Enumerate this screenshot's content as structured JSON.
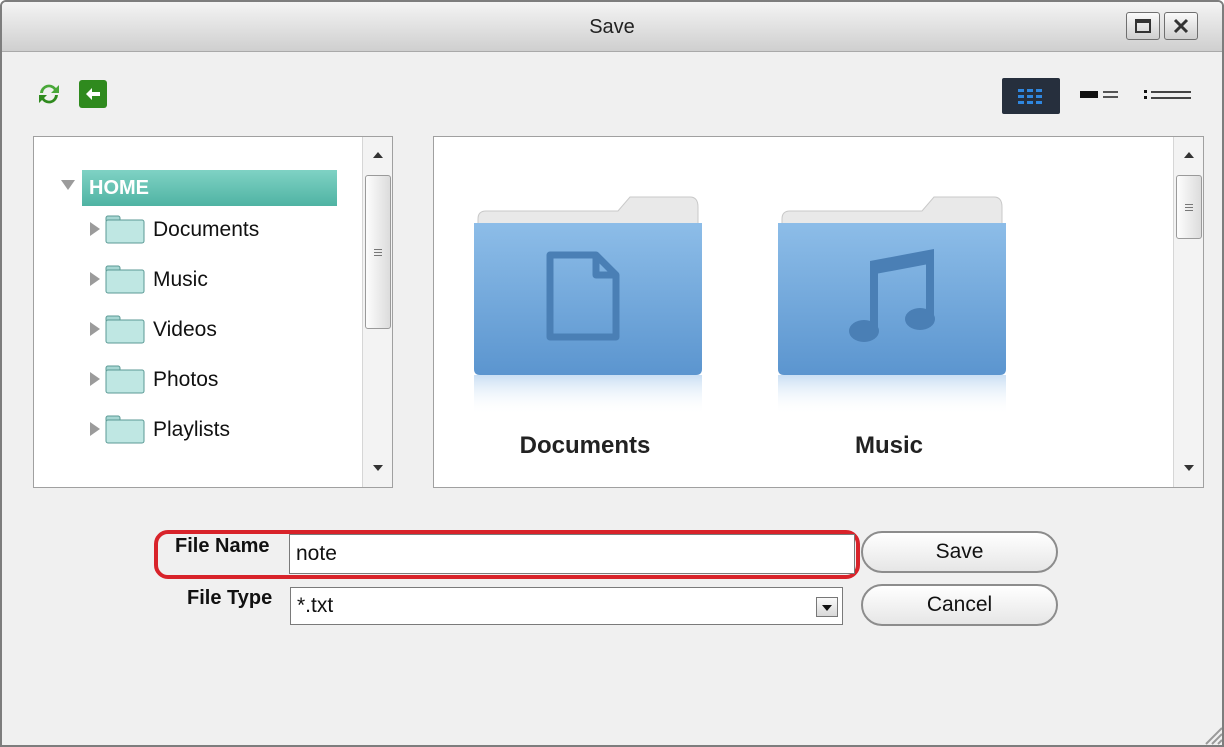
{
  "window": {
    "title": "Save"
  },
  "toolbar": {
    "refresh_icon": "refresh-icon",
    "back_icon": "back-arrow-icon",
    "views": [
      {
        "name": "thumbnails-view-icon",
        "active": true
      },
      {
        "name": "tiles-view-icon",
        "active": false
      },
      {
        "name": "list-view-icon",
        "active": false
      }
    ]
  },
  "tree": {
    "root": "HOME",
    "items": [
      {
        "label": "Documents"
      },
      {
        "label": "Music"
      },
      {
        "label": "Videos"
      },
      {
        "label": "Photos"
      },
      {
        "label": "Playlists"
      }
    ]
  },
  "files": [
    {
      "label": "Documents",
      "icon": "document-folder-icon"
    },
    {
      "label": "Music",
      "icon": "music-folder-icon"
    }
  ],
  "form": {
    "file_name_label": "File Name",
    "file_name_value": "note",
    "file_type_label": "File Type",
    "file_type_value": "*.txt",
    "save_label": "Save",
    "cancel_label": "Cancel"
  },
  "colors": {
    "selection": "#5fc1b1",
    "highlight": "#d8232a",
    "folder": "#6fa6d9"
  }
}
